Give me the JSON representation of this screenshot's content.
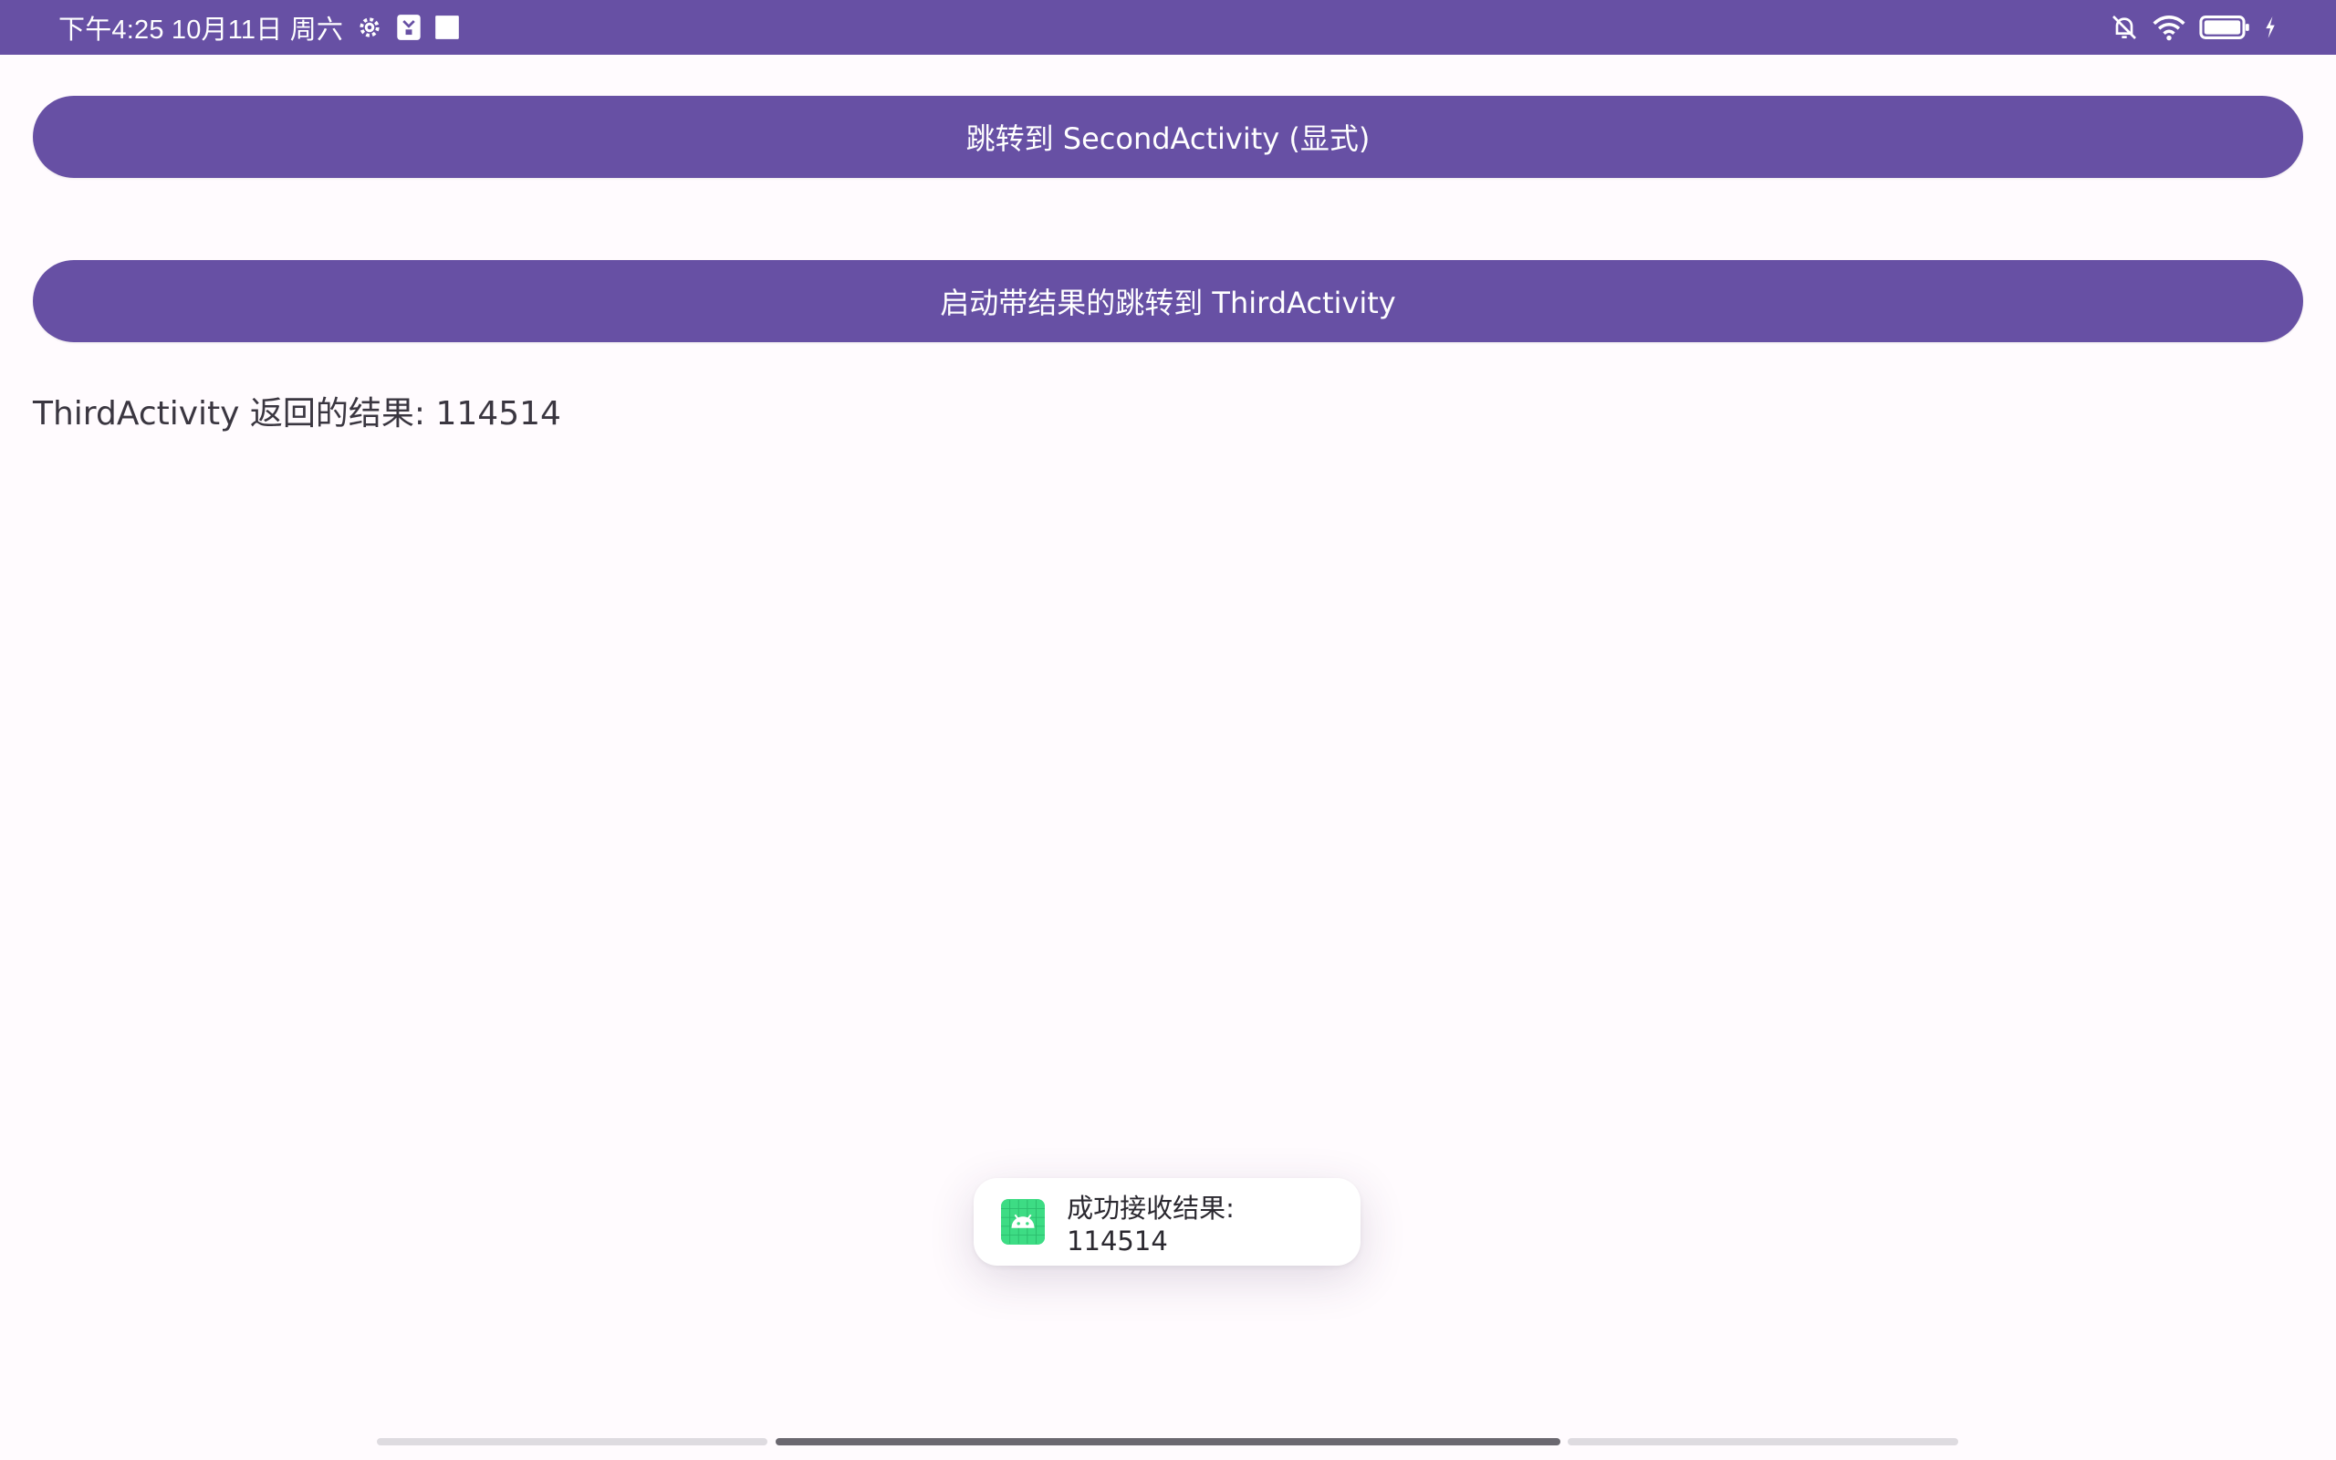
{
  "status_bar": {
    "datetime": "下午4:25 10月11日 周六",
    "left_icons": [
      "gear-icon",
      "app-notification-icon",
      "square-notification-icon"
    ],
    "right_icons": [
      "bell-off-icon",
      "wifi-icon",
      "battery-icon",
      "charging-icon"
    ],
    "color": "#6750a4"
  },
  "buttons": {
    "second_activity_label": "跳转到 SecondActivity (显式)",
    "third_activity_label": "启动带结果的跳转到 ThirdActivity"
  },
  "result": {
    "text": "ThirdActivity 返回的结果: 114514"
  },
  "toast": {
    "text": "成功接收结果: 114514",
    "icon": "android-app-icon"
  },
  "colors": {
    "primary": "#6750a4",
    "background": "#fffbfe",
    "android_green": "#3ddc84"
  }
}
